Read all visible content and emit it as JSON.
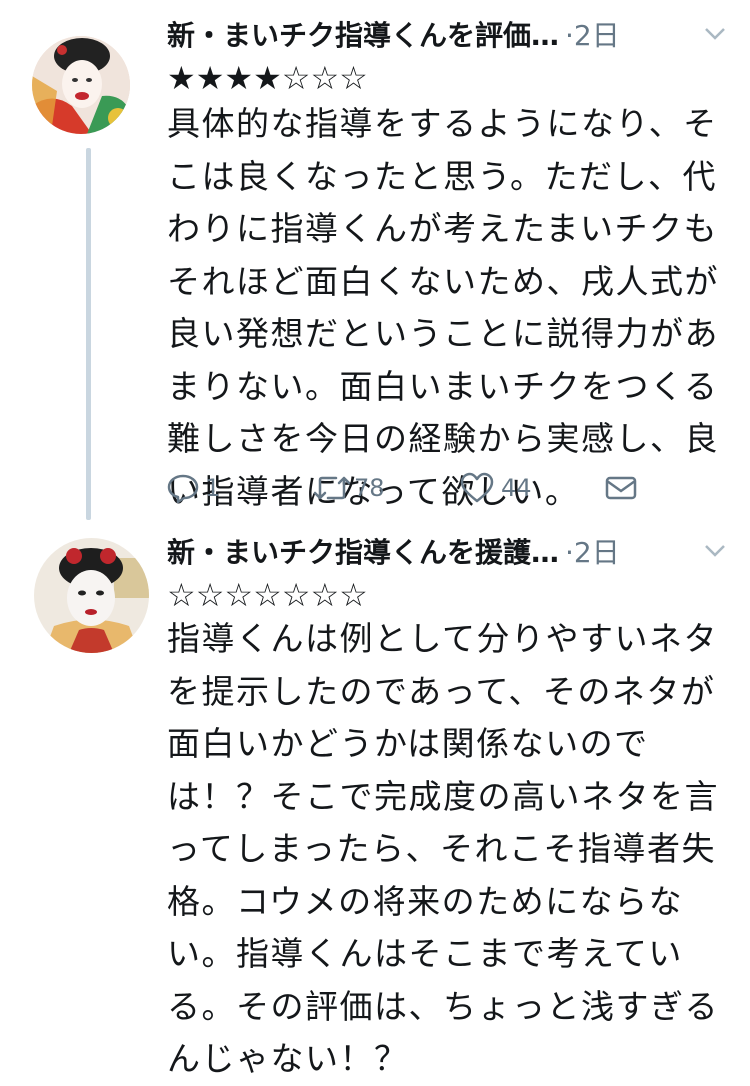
{
  "tweets": [
    {
      "name": "新・まいチク指導くんを評価…",
      "time": "·2日",
      "stars": "★★★★☆☆☆",
      "lines": [
        "具体的な指導をするようになり、そ",
        "こは良くなったと思う。ただし、代",
        "わりに指導くんが考えたまいチクも",
        "それほど面白くないため、戌人式が",
        "良い発想だということに説得力があ",
        "まりない。面白いまいチクをつくる",
        "難しさを今日の経験から実感し、良",
        "い指導者になって欲しい。"
      ],
      "actions": {
        "replies": "1",
        "retweets": "78",
        "likes": "44"
      }
    },
    {
      "name": "新・まいチク指導くんを援護…",
      "time": "·2日",
      "stars": "☆☆☆☆☆☆☆",
      "lines": [
        "指導くんは例として分りやすいネタ",
        "を提示したのであって、そのネタが",
        "面白いかどうかは関係ないので",
        "は！？そこで完成度の高いネタを言",
        "ってしまったら、それこそ指導者失",
        "格。コウメの将来のためにならな",
        "い。指導くんはそこまで考えてい",
        "る。その評価は、ちょっと浅すぎる",
        "んじゃない！？"
      ]
    }
  ]
}
